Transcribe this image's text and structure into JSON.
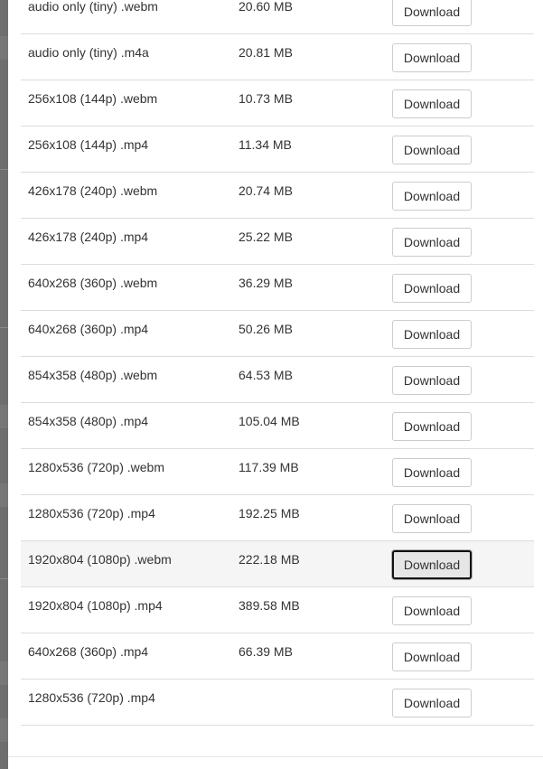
{
  "download_label": "Download",
  "rows": [
    {
      "format": "audio only (tiny) .webm",
      "size": "20.60 MB"
    },
    {
      "format": "audio only (tiny) .m4a",
      "size": "20.81 MB"
    },
    {
      "format": "256x108 (144p) .webm",
      "size": "10.73 MB"
    },
    {
      "format": "256x108 (144p) .mp4",
      "size": "11.34 MB"
    },
    {
      "format": "426x178 (240p) .webm",
      "size": "20.74 MB"
    },
    {
      "format": "426x178 (240p) .mp4",
      "size": "25.22 MB"
    },
    {
      "format": "640x268 (360p) .webm",
      "size": "36.29 MB"
    },
    {
      "format": "640x268 (360p) .mp4",
      "size": "50.26 MB"
    },
    {
      "format": "854x358 (480p) .webm",
      "size": "64.53 MB"
    },
    {
      "format": "854x358 (480p) .mp4",
      "size": "105.04 MB"
    },
    {
      "format": "1280x536 (720p) .webm",
      "size": "117.39 MB"
    },
    {
      "format": "1280x536 (720p) .mp4",
      "size": "192.25 MB"
    },
    {
      "format": "1920x804 (1080p) .webm",
      "size": "222.18 MB"
    },
    {
      "format": "1920x804 (1080p) .mp4",
      "size": "389.58 MB"
    },
    {
      "format": "640x268 (360p) .mp4",
      "size": "66.39 MB"
    },
    {
      "format": "1280x536 (720p) .mp4",
      "size": ""
    }
  ],
  "focused_row": 12,
  "colors": {
    "backdrop": "#6e6e6e",
    "row_border": "#dcdcdc",
    "highlight_row": "#f5f5f5",
    "text": "#333333",
    "button_border": "#cccccc",
    "focus_ring": "#111111"
  }
}
